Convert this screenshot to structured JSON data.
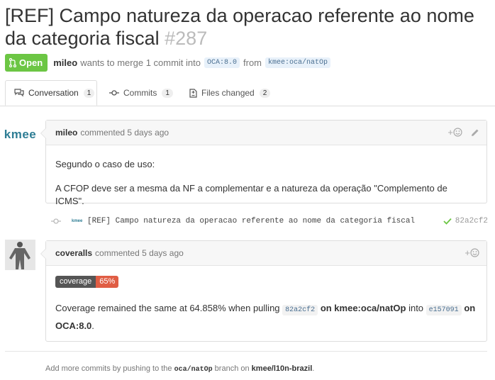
{
  "pr": {
    "title": "[REF] Campo natureza da operacao referente ao nome da categoria fiscal",
    "number": "#287",
    "state": "Open",
    "author": "mileo",
    "merge_text": "wants to merge 1 commit into",
    "base_branch": "OCA:8.0",
    "from_text": "from",
    "head_branch": "kmee:oca/natOp"
  },
  "tabs": [
    {
      "label": "Conversation",
      "count": "1"
    },
    {
      "label": "Commits",
      "count": "1"
    },
    {
      "label": "Files changed",
      "count": "2"
    }
  ],
  "comment1": {
    "avatar_text": "kmee",
    "author": "mileo",
    "action": "commented 5 days ago",
    "para1": "Segundo o caso de uso:",
    "para2": "A CFOP deve ser a mesma da NF a complementar e a natureza da operação \"Complemento de ICMS\"."
  },
  "commit": {
    "avatar_text": "kmee",
    "message": "[REF] Campo natureza da operacao referente ao nome da categoria fiscal",
    "sha": "82a2cf2"
  },
  "comment2": {
    "author": "coveralls",
    "action": "commented 5 days ago",
    "badge_label": "coverage",
    "badge_value": "65%",
    "text_before": "Coverage remained the same at 64.858% when pulling",
    "sha1": "82a2cf2",
    "on1": "on kmee:oca/natOp",
    "into": "into",
    "sha2": "e157091",
    "on2": "on",
    "on2b": "OCA:8.0",
    "period": "."
  },
  "footer": {
    "prefix": "Add more commits by pushing to the",
    "branch": "oca/natOp",
    "middle": "branch on",
    "repo": "kmee/l10n-brazil",
    "suffix": "."
  },
  "colors": {
    "open_green": "#6cc644",
    "badge_gray": "#555555",
    "badge_red": "#e05d44",
    "check_green": "#6cc644"
  }
}
